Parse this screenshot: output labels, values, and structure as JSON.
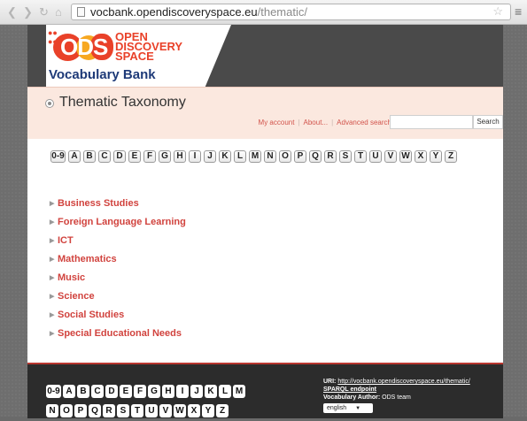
{
  "browser": {
    "url_host": "vocbank.opendiscoveryspace.eu",
    "url_path": "/thematic/"
  },
  "logo": {
    "mark": "ODS",
    "line1": "OPEN",
    "line2": "DISCOVERY",
    "line3": "SPACE",
    "site_name": "Vocabulary Bank"
  },
  "page": {
    "title": "Thematic Taxonomy"
  },
  "toplinks": [
    "My account",
    "About...",
    "Advanced search"
  ],
  "search": {
    "placeholder": "",
    "button": "Search"
  },
  "letters": [
    "0-9",
    "A",
    "B",
    "C",
    "D",
    "E",
    "F",
    "G",
    "H",
    "I",
    "J",
    "K",
    "L",
    "M",
    "N",
    "O",
    "P",
    "Q",
    "R",
    "S",
    "T",
    "U",
    "V",
    "W",
    "X",
    "Y",
    "Z"
  ],
  "topics": [
    "Business Studies",
    "Foreign Language Learning",
    "ICT",
    "Mathematics",
    "Music",
    "Science",
    "Social Studies",
    "Special Educational Needs"
  ],
  "footer": {
    "uri_label": "URI:",
    "uri_value": "http://vocbank.opendiscoveryspace.eu/thematic/",
    "sparql": "SPARQL endpoint",
    "author_label": "Vocabulary Author:",
    "author_value": "ODS team",
    "language": "english"
  },
  "colors": {
    "accent": "#d1433e",
    "band": "#fbe8df",
    "footer": "#2c2c2c"
  }
}
